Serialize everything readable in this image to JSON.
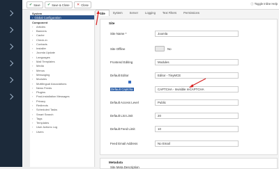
{
  "toolbar": {
    "save": "Save",
    "save_close": "Save & Close",
    "close": "Close",
    "toggle_help": "Toggle Inline Help"
  },
  "sidebar": {
    "system_heading": "System",
    "active_item": "Global Configuration",
    "components_heading": "Component",
    "items": [
      "Articles",
      "Banners",
      "Cache",
      "Check-in",
      "Contacts",
      "Installer",
      "Joomla Update",
      "Languages",
      "Mail Templates",
      "Media",
      "Menus",
      "Messaging",
      "Modules",
      "Multilingual Associations",
      "News Feeds",
      "Plugins",
      "Post-installation Messages",
      "Privacy",
      "Redirects",
      "Scheduled Tasks",
      "Smart Search",
      "Tags",
      "Templates",
      "User Actions Log",
      "Users"
    ]
  },
  "tabs": [
    "Site",
    "System",
    "Server",
    "Logging",
    "Text Filters",
    "Permissions"
  ],
  "site_section": {
    "title": "Site",
    "fields": {
      "site_name": {
        "label": "Site Name *",
        "value": "Joomla"
      },
      "site_offline": {
        "label": "Site Offline",
        "value": "No"
      },
      "frontend_editing": {
        "label": "Frontend Editing",
        "value": "Modules"
      },
      "default_editor": {
        "label": "Default Editor",
        "value": "Editor - TinyMCE"
      },
      "default_captcha": {
        "label": "Default Captcha",
        "value": "CAPTCHA - Invisible reCAPTCHA"
      },
      "default_access": {
        "label": "Default Access Level",
        "value": "Public"
      },
      "default_list_limit": {
        "label": "Default List Limit",
        "value": "20"
      },
      "default_feed_limit": {
        "label": "Default Feed Limit",
        "value": "10"
      },
      "feed_email": {
        "label": "Feed Email Address",
        "value": "No Email"
      }
    }
  },
  "metadata_section": {
    "title": "Metadata",
    "first_label": "Site Meta Description"
  },
  "colors": {
    "leftbar": "#1c2a3a",
    "active": "#2a5289",
    "arrow": "#d62020"
  }
}
